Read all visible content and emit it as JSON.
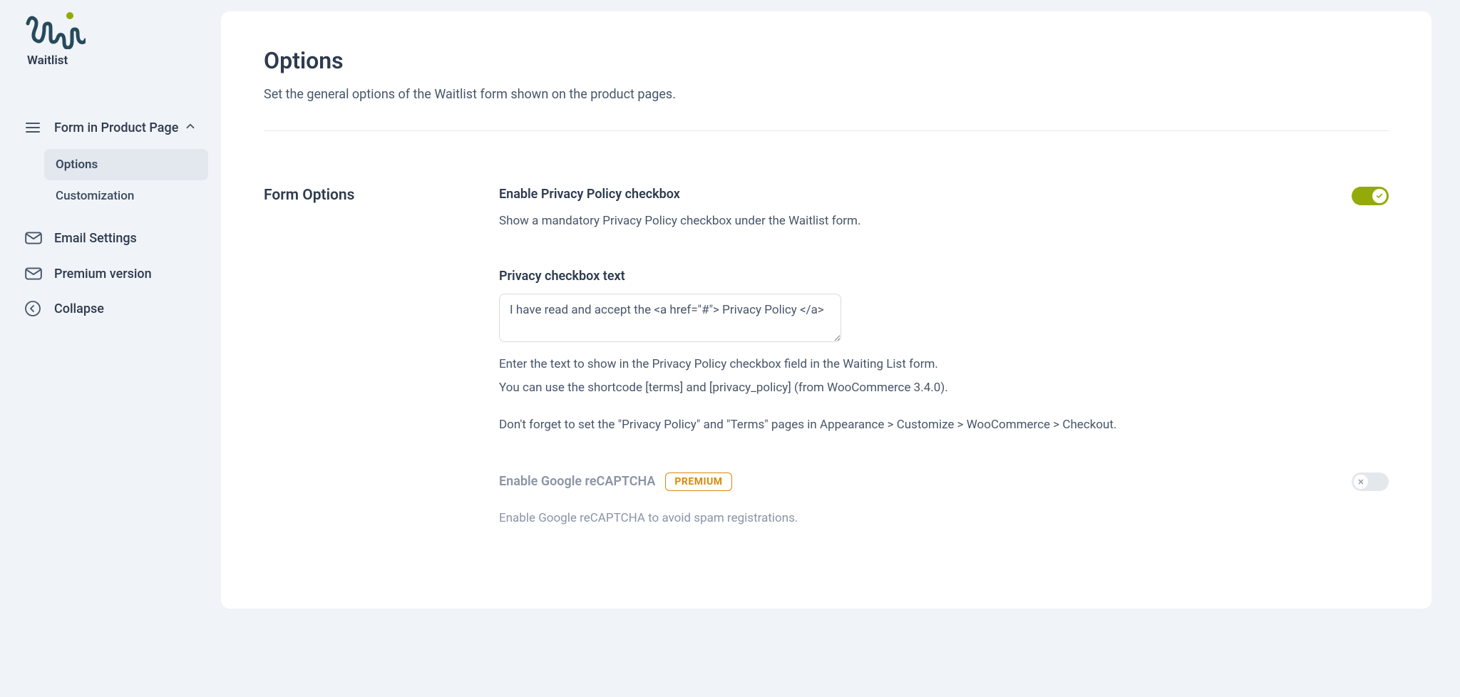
{
  "brand": {
    "plugin_name": "Waitlist"
  },
  "sidebar": {
    "items": [
      {
        "label": "Form in Product Page"
      },
      {
        "label": "Email Settings"
      },
      {
        "label": "Premium version"
      },
      {
        "label": "Collapse"
      }
    ],
    "sub": {
      "options": "Options",
      "customization": "Customization"
    }
  },
  "panel": {
    "title": "Options",
    "description": "Set the general options of the Waitlist form shown on the product pages."
  },
  "section": {
    "label": "Form Options"
  },
  "fields": {
    "privacy_enable": {
      "title": "Enable Privacy Policy checkbox",
      "desc": "Show a mandatory Privacy Policy checkbox under the Waitlist form."
    },
    "privacy_text": {
      "title": "Privacy checkbox text",
      "value": "I have read and accept the <a href=\"#\"> Privacy Policy </a>",
      "help1a": "Enter the text to show in the Privacy Policy checkbox field in the Waiting List form.",
      "help1b": "You can use the shortcode [terms] and [privacy_policy] (from WooCommerce 3.4.0).",
      "help2": "Don't forget to set the \"Privacy Policy\" and \"Terms\" pages in Appearance > Customize > WooCommerce > Checkout."
    },
    "recaptcha": {
      "title": "Enable Google reCAPTCHA",
      "badge": "PREMIUM",
      "desc": "Enable Google reCAPTCHA to avoid spam registrations."
    }
  }
}
